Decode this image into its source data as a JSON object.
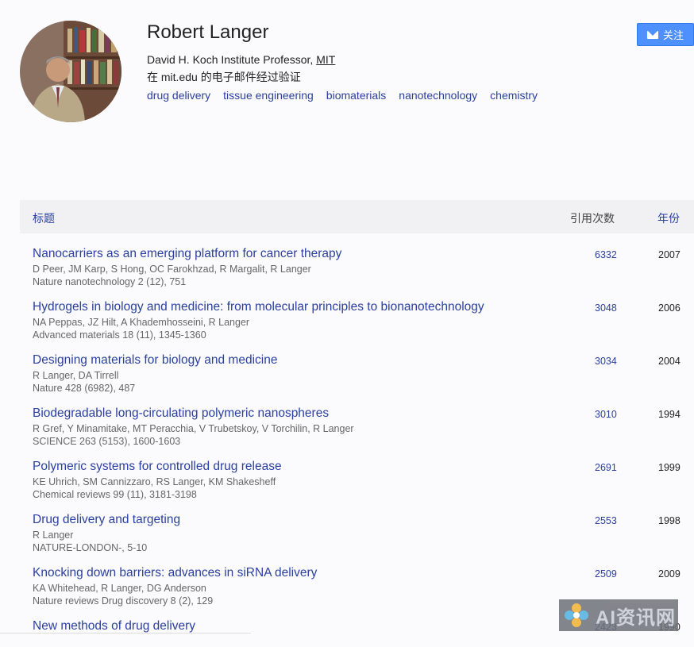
{
  "profile": {
    "name": "Robert Langer",
    "affiliation_prefix": "David H. Koch Institute Professor, ",
    "affiliation_org": "MIT",
    "email_verified": "在 mit.edu 的电子邮件经过验证",
    "interests": [
      "drug delivery",
      "tissue engineering",
      "biomaterials",
      "nanotechnology",
      "chemistry"
    ],
    "follow_label": "关注"
  },
  "table": {
    "header_title": "标题",
    "header_cites": "引用次数",
    "header_year": "年份",
    "rows": [
      {
        "title": "Nanocarriers as an emerging platform for cancer therapy",
        "authors": "D Peer, JM Karp, S Hong, OC Farokhzad, R Margalit, R Langer",
        "venue": "Nature nanotechnology 2 (12), 751",
        "cites": "6332",
        "year": "2007"
      },
      {
        "title": "Hydrogels in biology and medicine: from molecular principles to bionanotechnology",
        "authors": "NA Peppas, JZ Hilt, A Khademhosseini, R Langer",
        "venue": "Advanced materials 18 (11), 1345-1360",
        "cites": "3048",
        "year": "2006"
      },
      {
        "title": "Designing materials for biology and medicine",
        "authors": "R Langer, DA Tirrell",
        "venue": "Nature 428 (6982), 487",
        "cites": "3034",
        "year": "2004"
      },
      {
        "title": "Biodegradable long-circulating polymeric nanospheres",
        "authors": "R Gref, Y Minamitake, MT Peracchia, V Trubetskoy, V Torchilin, R Langer",
        "venue": "SCIENCE 263 (5153), 1600-1603",
        "cites": "3010",
        "year": "1994"
      },
      {
        "title": "Polymeric systems for controlled drug release",
        "authors": "KE Uhrich, SM Cannizzaro, RS Langer, KM Shakesheff",
        "venue": "Chemical reviews 99 (11), 3181-3198",
        "cites": "2691",
        "year": "1999"
      },
      {
        "title": "Drug delivery and targeting",
        "authors": "R Langer",
        "venue": "NATURE-LONDON-, 5-10",
        "cites": "2553",
        "year": "1998"
      },
      {
        "title": "Knocking down barriers: advances in siRNA delivery",
        "authors": "KA Whitehead, R Langer, DG Anderson",
        "venue": "Nature reviews Drug discovery 8 (2), 129",
        "cites": "2509",
        "year": "2009"
      },
      {
        "title": "New methods of drug delivery",
        "authors": "",
        "venue": "",
        "cites": "2423",
        "year": "1990"
      }
    ]
  },
  "watermark": {
    "text": "AI资讯网"
  }
}
